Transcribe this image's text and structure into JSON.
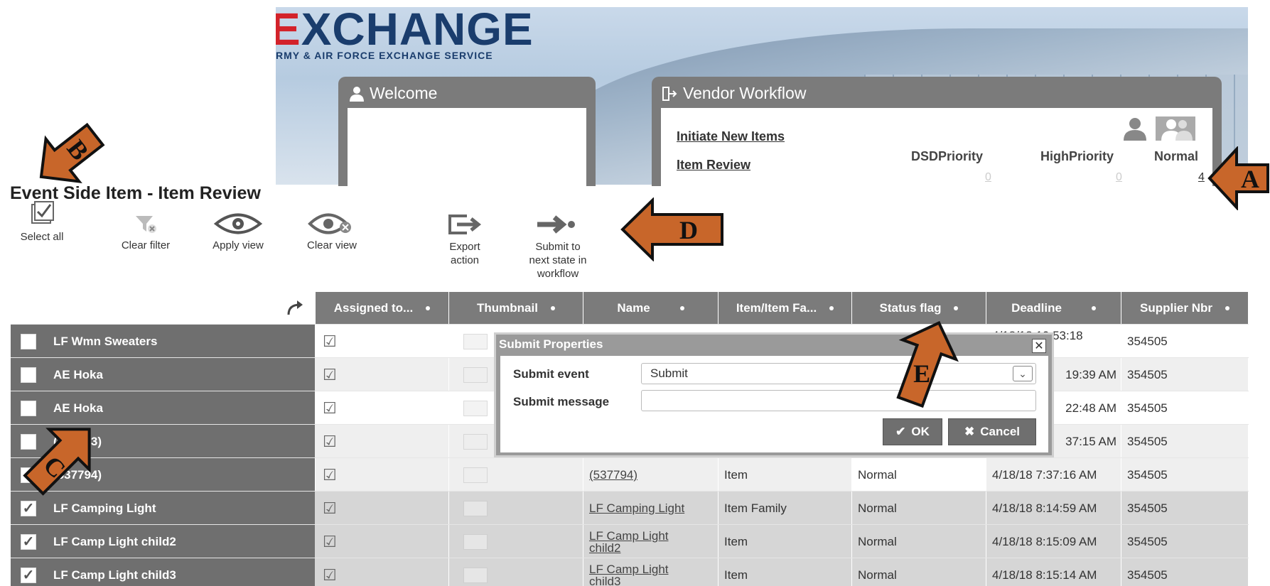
{
  "banner": {
    "logo_text_main": "XCHANGE",
    "logo_text_first": "E",
    "logo_tm": "™",
    "logo_subtitle": "RMY & AIR FORCE EXCHANGE SERVICE"
  },
  "welcome_portlet": {
    "title": "Welcome"
  },
  "vendor_workflow": {
    "title": "Vendor Workflow",
    "links": [
      "Initiate New Items",
      "Item Review"
    ],
    "columns": [
      "DSDPriority",
      "HighPriority",
      "Normal"
    ],
    "values": [
      "0",
      "0",
      "4"
    ]
  },
  "page_title": "Event Side Item - Item Review",
  "toolbar": {
    "select_all": "Select all",
    "clear_filter": "Clear filter",
    "apply_view": "Apply view",
    "clear_view": "Clear view",
    "export_action_l1": "Export",
    "export_action_l2": "action",
    "submit_l1": "Submit to",
    "submit_l2": "next state in",
    "submit_l3": "workflow"
  },
  "grid": {
    "headers": [
      "Assigned to...",
      "Thumbnail",
      "Name",
      "Item/Item Fa...",
      "Status flag",
      "Deadline",
      "Supplier Nbr"
    ],
    "rows": [
      {
        "label": "LF Wmn Sweaters",
        "checked": false,
        "name": "",
        "type": "",
        "status": "",
        "deadline": "4/18/18 10:53:18",
        "supplier": "354505"
      },
      {
        "label": "AE Hoka",
        "checked": false,
        "name": "",
        "type": "",
        "status": "",
        "deadline": "19:39 AM",
        "supplier": "354505"
      },
      {
        "label": "AE Hoka",
        "checked": false,
        "name": "",
        "type": "",
        "status": "",
        "deadline": "22:48 AM",
        "supplier": "354505"
      },
      {
        "label": "(537793)",
        "checked": false,
        "name": "",
        "type": "",
        "status": "",
        "deadline": "37:15 AM",
        "supplier": "354505"
      },
      {
        "label": "(537794)",
        "checked": false,
        "name": "(537794)",
        "type": "Item",
        "status": "Normal",
        "deadline": "4/18/18 7:37:16 AM",
        "supplier": "354505"
      },
      {
        "label": "LF Camping Light",
        "checked": true,
        "name": "LF Camping Light",
        "type": "Item Family",
        "status": "Normal",
        "deadline": "4/18/18 8:14:59 AM",
        "supplier": "354505"
      },
      {
        "label": "LF Camp Light child2",
        "checked": true,
        "name_l1": "LF Camp Light",
        "name_l2": "child2",
        "type": "Item",
        "status": "Normal",
        "deadline": "4/18/18 8:15:09 AM",
        "supplier": "354505"
      },
      {
        "label": "LF Camp Light child3",
        "checked": true,
        "name_l1": "LF Camp Light",
        "name_l2": "child3",
        "type": "Item",
        "status": "Normal",
        "deadline": "4/18/18 8:15:14 AM",
        "supplier": "354505"
      }
    ]
  },
  "modal": {
    "title": "Submit Properties",
    "event_label": "Submit event",
    "event_value": "Submit",
    "message_label": "Submit message",
    "message_value": "",
    "ok_label": "OK",
    "cancel_label": "Cancel"
  },
  "annotations": [
    "A",
    "B",
    "C",
    "D",
    "E"
  ],
  "colors": {
    "annotation_fill": "#c8662a",
    "header_gray": "#7b7b7b",
    "row_gray": "#6f6f6f"
  }
}
